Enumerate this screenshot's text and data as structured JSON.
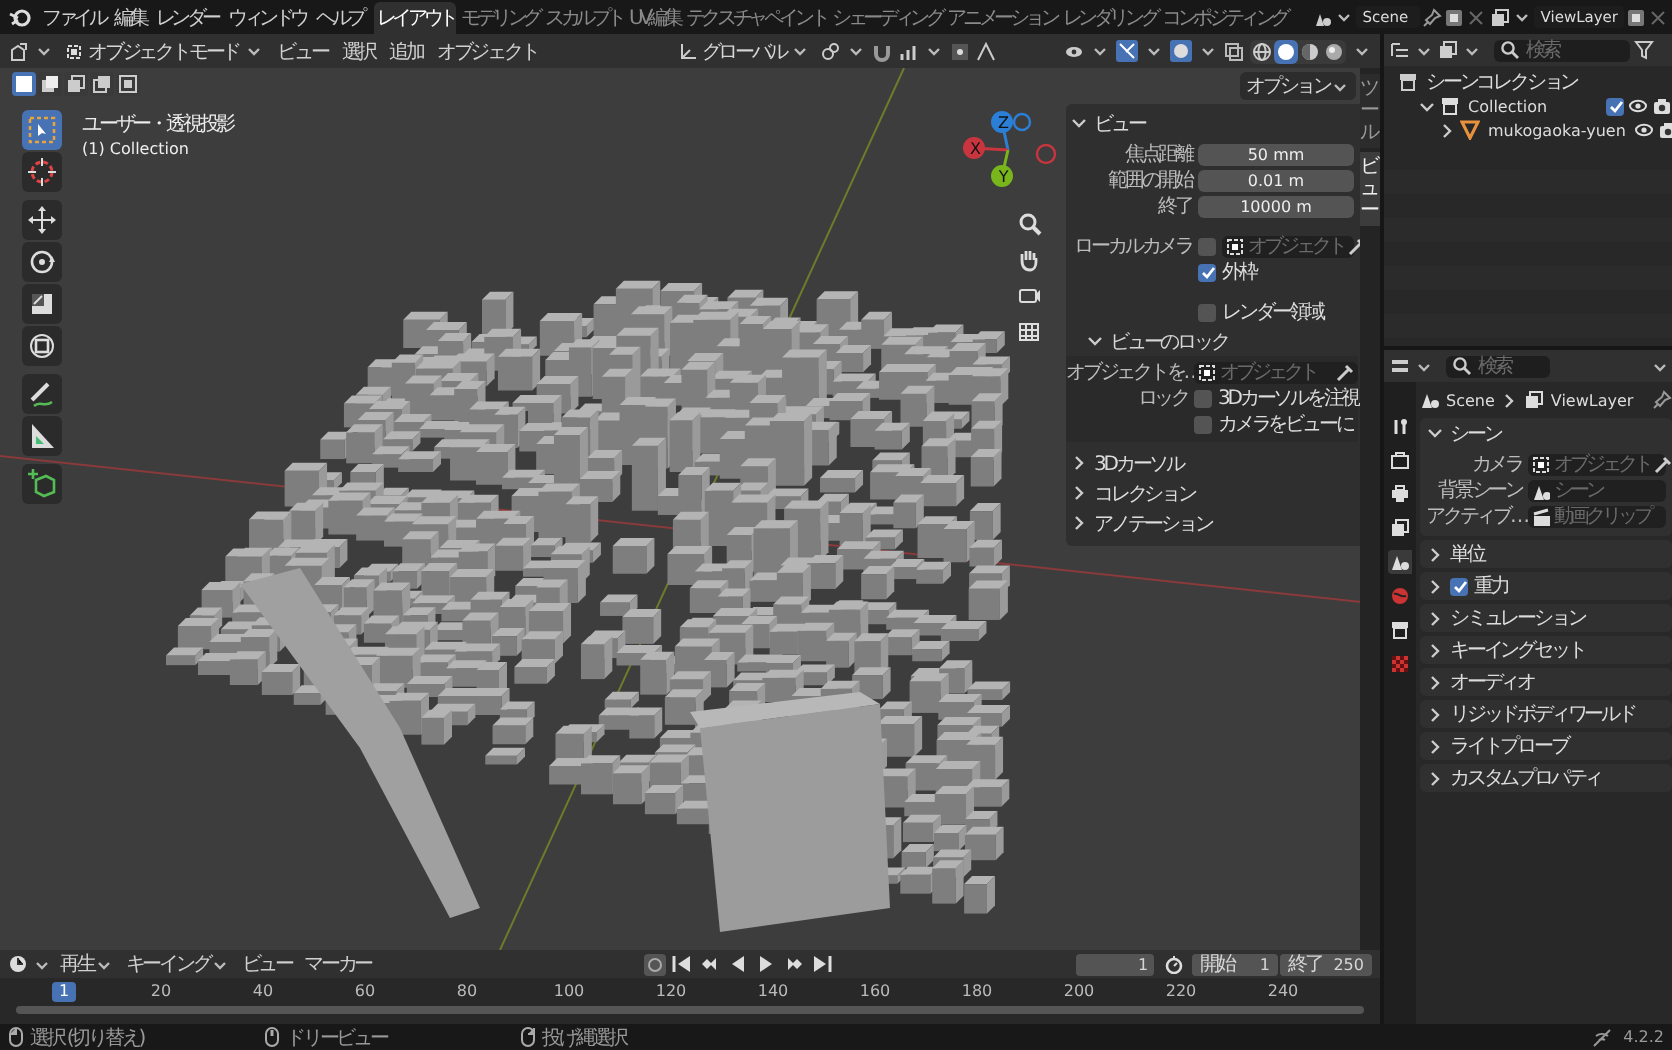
{
  "top_bar": {
    "menus": [
      "ファイル",
      "編集",
      "レンダー",
      "ウィンドウ",
      "ヘルプ"
    ],
    "workspaces": [
      {
        "label": "レイアウト",
        "selected": true
      },
      {
        "label": "モデリング",
        "selected": false
      },
      {
        "label": "スカルプト",
        "selected": false
      },
      {
        "label": "UV編集",
        "selected": false
      },
      {
        "label": "テクスチャペイント",
        "selected": false
      },
      {
        "label": "シェーディング",
        "selected": false
      },
      {
        "label": "アニメーション",
        "selected": false
      },
      {
        "label": "レンダリング",
        "selected": false
      },
      {
        "label": "コンポジティング",
        "selected": false
      }
    ],
    "scene": "Scene",
    "view_layer": "ViewLayer"
  },
  "viewport": {
    "mode": "オブジェクトモード",
    "menus": [
      "ビュー",
      "選択",
      "追加",
      "オブジェクト"
    ],
    "orientation": "グローバル",
    "options_button": "オプション",
    "select_modes": [
      {
        "kind": "new",
        "selected": true
      },
      {
        "kind": "extend",
        "selected": false
      },
      {
        "kind": "subtract",
        "selected": false
      },
      {
        "kind": "invert",
        "selected": false
      },
      {
        "kind": "intersect",
        "selected": false
      }
    ],
    "tool_groups": [
      [
        {
          "kind": "select",
          "selected": true
        },
        {
          "kind": "cursor",
          "selected": false
        }
      ],
      [
        {
          "kind": "move",
          "selected": false
        },
        {
          "kind": "rotate",
          "selected": false
        },
        {
          "kind": "scale",
          "selected": false
        },
        {
          "kind": "transform",
          "selected": false
        }
      ],
      [
        {
          "kind": "annotate",
          "selected": false
        },
        {
          "kind": "measure",
          "selected": false
        }
      ],
      [
        {
          "kind": "add_cube",
          "selected": false
        }
      ]
    ],
    "shading": [
      {
        "kind": "wireframe",
        "selected": false
      },
      {
        "kind": "solid",
        "selected": true
      },
      {
        "kind": "material",
        "selected": false
      },
      {
        "kind": "rendered",
        "selected": false
      }
    ],
    "overlay_text": [
      "ユーザー・透視投影",
      "(1) Collection"
    ],
    "gizmo_axes": [
      {
        "kind": "z",
        "label": "Z",
        "color": "#2c7fd6"
      },
      {
        "kind": "x",
        "label": "X",
        "color": "#c8353f"
      },
      {
        "kind": "y",
        "label": "Y",
        "color": "#79b61c"
      }
    ],
    "sidebar_tabs": [
      {
        "label": "ツール",
        "selected": false
      },
      {
        "label": "ビュー",
        "selected": true
      }
    ]
  },
  "view_panel": {
    "title": "ビュー",
    "expanded": true,
    "fields": [
      {
        "label": "焦点距離",
        "value": "50 mm"
      },
      {
        "label": "範囲の開始",
        "value": "0.01 m"
      },
      {
        "label": "終了",
        "value": "10000 m"
      }
    ],
    "local_camera": {
      "label": "ローカルカメラ",
      "checked": false,
      "placeholder": "オブジェクト"
    },
    "checks": [
      {
        "label": "外枠",
        "checked": true
      },
      {
        "label": "レンダー領域",
        "checked": false
      }
    ],
    "lock": {
      "title": "ビューのロック",
      "expanded": true,
      "object_label": "オブジェクトを…",
      "placeholder": "オブジェクト",
      "lock_label": "ロック",
      "checks": [
        {
          "label": "3Dカーソルを注視",
          "checked": false
        },
        {
          "label": "カメラをビューに",
          "checked": false
        }
      ]
    },
    "panels": [
      {
        "title": "3Dカーソル",
        "expanded": false
      },
      {
        "title": "コレクション",
        "expanded": false
      },
      {
        "title": "アノテーション",
        "expanded": false
      }
    ]
  },
  "outliner": {
    "search_placeholder": "検索",
    "tree": [
      {
        "label": "シーンコレクション",
        "kind": "scene_collection",
        "children": [
          {
            "label": "Collection",
            "kind": "collection",
            "expanded": true,
            "checked": true,
            "children": [
              {
                "label": "mukogaoka-yuen",
                "kind": "mesh",
                "expanded": false
              }
            ]
          }
        ]
      }
    ]
  },
  "properties": {
    "search_placeholder": "検索",
    "tabs": [
      {
        "kind": "tool",
        "selected": false
      },
      {
        "kind": "render",
        "selected": false
      },
      {
        "kind": "output",
        "selected": false
      },
      {
        "kind": "view_layer",
        "selected": false
      },
      {
        "kind": "scene",
        "selected": true
      },
      {
        "kind": "world",
        "selected": false
      },
      {
        "kind": "collection",
        "selected": false
      },
      {
        "kind": "texture",
        "selected": false
      }
    ],
    "breadcrumb": [
      "Scene",
      "ViewLayer"
    ],
    "scene_panel": {
      "title": "シーン",
      "expanded": true,
      "fields": [
        {
          "label": "カメラ",
          "placeholder": "オブジェクト",
          "kind": "object"
        },
        {
          "label": "背景シーン",
          "placeholder": "シーン",
          "kind": "scene"
        },
        {
          "label": "アクティブ…",
          "placeholder": "動画クリップ",
          "kind": "clip"
        }
      ]
    },
    "panels": [
      {
        "title": "単位",
        "expanded": false
      },
      {
        "title": "重力",
        "expanded": false,
        "checked": true
      },
      {
        "title": "シミュレーション",
        "expanded": false
      },
      {
        "title": "キーイングセット",
        "expanded": false
      },
      {
        "title": "オーディオ",
        "expanded": false
      },
      {
        "title": "リジッドボディワールド",
        "expanded": false
      },
      {
        "title": "ライトプローブ",
        "expanded": false
      },
      {
        "title": "カスタムプロパティ",
        "expanded": false
      }
    ]
  },
  "timeline": {
    "menus": [
      {
        "label": "再生",
        "dropdown": true
      },
      {
        "label": "キーイング",
        "dropdown": true
      },
      {
        "label": "ビュー",
        "dropdown": false
      },
      {
        "label": "マーカー",
        "dropdown": false
      }
    ],
    "current_frame": "1",
    "start_label": "開始",
    "start": "1",
    "end_label": "終了",
    "end": "250",
    "playhead": "1",
    "ticks": [
      "20",
      "40",
      "60",
      "80",
      "100",
      "120",
      "140",
      "160",
      "180",
      "200",
      "220",
      "240"
    ]
  },
  "status_bar": {
    "hints": [
      "選択 (切り替え)",
      "ドリービュー",
      "投げ縄選択"
    ],
    "version": "4.2.2"
  }
}
